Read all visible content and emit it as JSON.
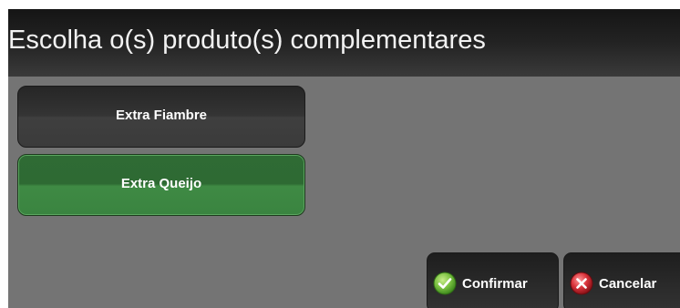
{
  "dialog": {
    "title": "Escolha o(s) produto(s) complementares"
  },
  "products": [
    {
      "label": "Extra Fiambre",
      "selected": false
    },
    {
      "label": "Extra Queijo",
      "selected": true
    }
  ],
  "actions": {
    "confirm_label": "Confirmar",
    "cancel_label": "Cancelar"
  },
  "colors": {
    "dialog_background": "#747474",
    "titlebar": "#1a1a1a",
    "button_dark": "#363636",
    "button_selected_green": "#3a8440",
    "confirm_icon_green": "#7cc242",
    "cancel_icon_red": "#d9323a"
  },
  "icons": {
    "confirm": "checkmark-circle-icon",
    "cancel": "x-circle-icon"
  }
}
